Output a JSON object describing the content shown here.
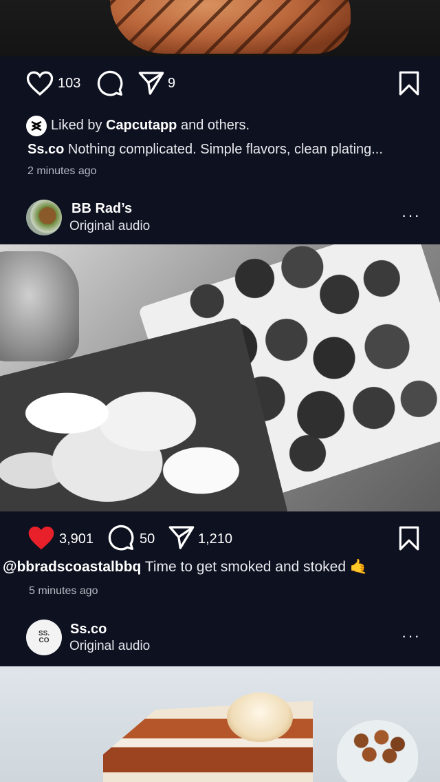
{
  "post1": {
    "likes": "103",
    "shares": "9",
    "liked_by_prefix": "Liked by ",
    "liked_by_user": "Capcutapp",
    "liked_by_suffix": " and others.",
    "caption_user": "Ss.co",
    "caption_text": " Nothing complicated. Simple flavors, clean plating...",
    "time": "2 minutes ago"
  },
  "post2": {
    "account_name": "BB Rad’s",
    "audio": "Original audio",
    "more": "···",
    "likes": "3,901",
    "comments": "50",
    "shares": "1,210",
    "caption_user": "@bbradscoastalbbq",
    "caption_text": " Time to get smoked and stoked 🤙",
    "time": "5 minutes ago",
    "liked": true
  },
  "post3": {
    "account_name": "Ss.co",
    "audio": "Original audio",
    "more": "···",
    "avatar_text": "SS. CO"
  },
  "colors": {
    "background": "#0d1120",
    "like_red": "#e8202a",
    "muted_text": "#b7bac3"
  },
  "icons": [
    "heart-icon",
    "comment-icon",
    "share-icon",
    "bookmark-icon",
    "capcut-logo-icon",
    "more-icon"
  ]
}
